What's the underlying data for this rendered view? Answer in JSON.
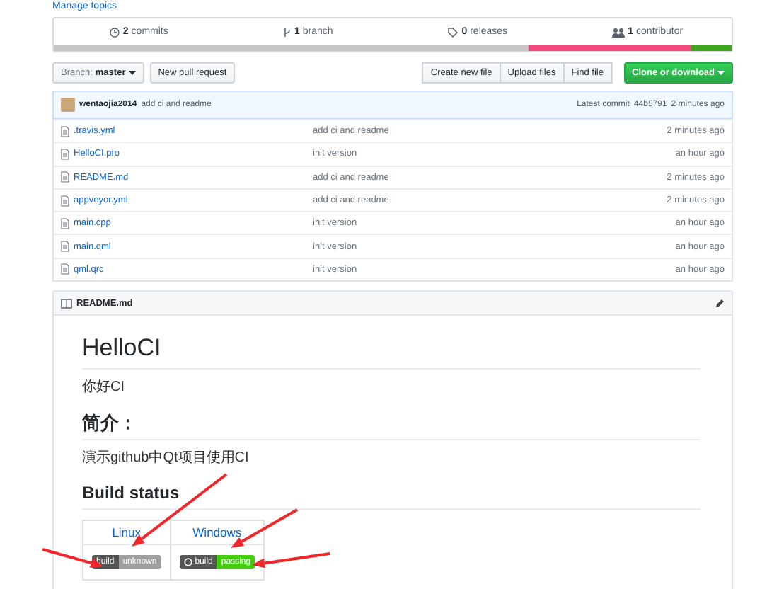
{
  "top_link": "Manage topics",
  "stats": [
    {
      "kind": "commits",
      "count": "2",
      "label": "commits"
    },
    {
      "kind": "branch",
      "count": "1",
      "label": "branch"
    },
    {
      "kind": "releases",
      "count": "0",
      "label": "releases"
    },
    {
      "kind": "contributor",
      "count": "1",
      "label": "contributor"
    }
  ],
  "branch_button": {
    "label": "Branch:",
    "value": "master"
  },
  "pull_request_button": "New pull request",
  "file_buttons": [
    "Create new file",
    "Upload files",
    "Find file"
  ],
  "clone_button": "Clone or download",
  "commit": {
    "author": "wentaojia2014",
    "message": "add ci and readme",
    "latest_label": "Latest commit",
    "hash": "44b5791",
    "time": "2 minutes ago"
  },
  "files": [
    {
      "name": ".travis.yml",
      "message": "add ci and readme",
      "age": "2 minutes ago"
    },
    {
      "name": "HelloCI.pro",
      "message": "init version",
      "age": "an hour ago"
    },
    {
      "name": "README.md",
      "message": "add ci and readme",
      "age": "2 minutes ago"
    },
    {
      "name": "appveyor.yml",
      "message": "add ci and readme",
      "age": "2 minutes ago"
    },
    {
      "name": "main.cpp",
      "message": "init version",
      "age": "an hour ago"
    },
    {
      "name": "main.qml",
      "message": "init version",
      "age": "an hour ago"
    },
    {
      "name": "qml.qrc",
      "message": "init version",
      "age": "an hour ago"
    }
  ],
  "readme": {
    "filename": "README.md",
    "blocks": [
      {
        "kind": "h1",
        "text": "HelloCI"
      },
      {
        "kind": "p",
        "text": "你好CI"
      },
      {
        "kind": "h2",
        "text": "简介："
      },
      {
        "kind": "p",
        "text": "演示github中Qt项目使用CI"
      },
      {
        "kind": "h3",
        "text": "Build status"
      }
    ],
    "status_table": {
      "columns": [
        "Linux",
        "Windows"
      ],
      "badges": [
        {
          "label": "build",
          "status": "unknown",
          "color": "#9f9f9f",
          "logo": false
        },
        {
          "label": "build",
          "status": "passing",
          "color": "#44cc11",
          "logo": true
        }
      ]
    }
  }
}
